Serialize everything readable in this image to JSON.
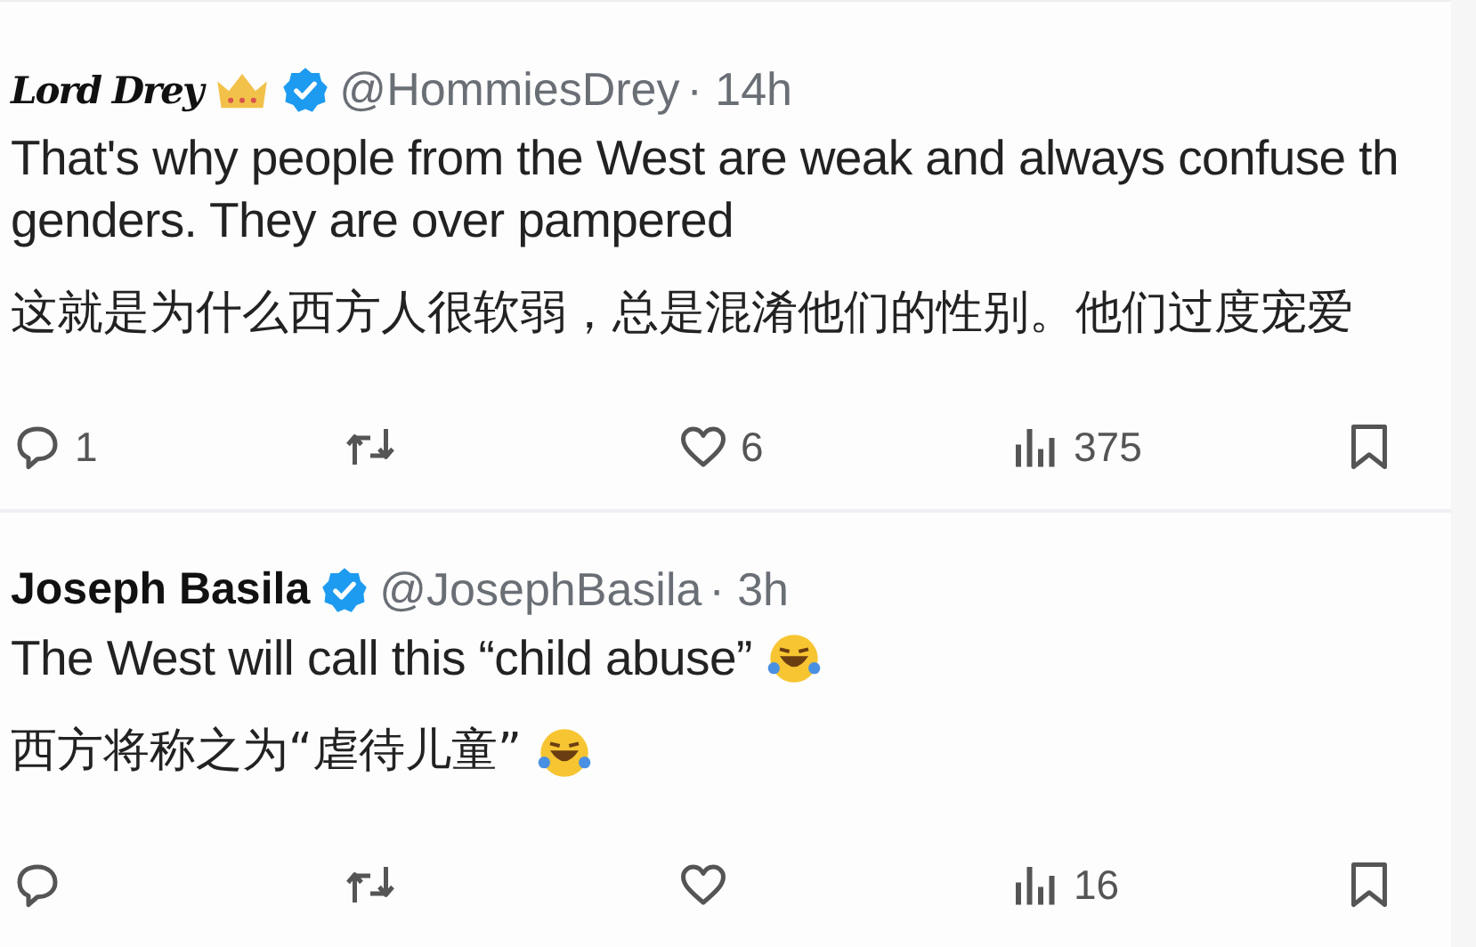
{
  "tweets": [
    {
      "kind": "script-name",
      "name": "Lord Drey",
      "badges": [
        {
          "kind": "crown"
        },
        {
          "kind": "verified"
        }
      ],
      "handle": "@HommiesDrey",
      "time": "· 14h",
      "lines": [
        "That's why people from the West are weak and always confuse th",
        "genders. They are over pampered"
      ],
      "emoji_after_text": false,
      "translation": "这就是为什么西方人很软弱，总是混淆他们的性别。他们过度宠爱",
      "emoji_after_translation": false,
      "actions": [
        {
          "kind": "reply",
          "count": "1"
        },
        {
          "kind": "repost"
        },
        {
          "kind": "like",
          "count": "6"
        },
        {
          "kind": "views",
          "count": "375"
        },
        {
          "kind": "bookmark"
        }
      ]
    },
    {
      "kind": "bold-name",
      "name": "Joseph Basila",
      "badges": [
        {
          "kind": "verified"
        }
      ],
      "handle": "@JosephBasila",
      "time": "· 3h",
      "lines": [
        "The West will call this “child abuse”"
      ],
      "emoji_after_text": true,
      "translation": "西方将称之为“虐待儿童”",
      "emoji_after_translation": true,
      "actions": [
        {
          "kind": "reply"
        },
        {
          "kind": "repost"
        },
        {
          "kind": "like"
        },
        {
          "kind": "views",
          "count": "16"
        },
        {
          "kind": "bookmark"
        }
      ]
    }
  ]
}
